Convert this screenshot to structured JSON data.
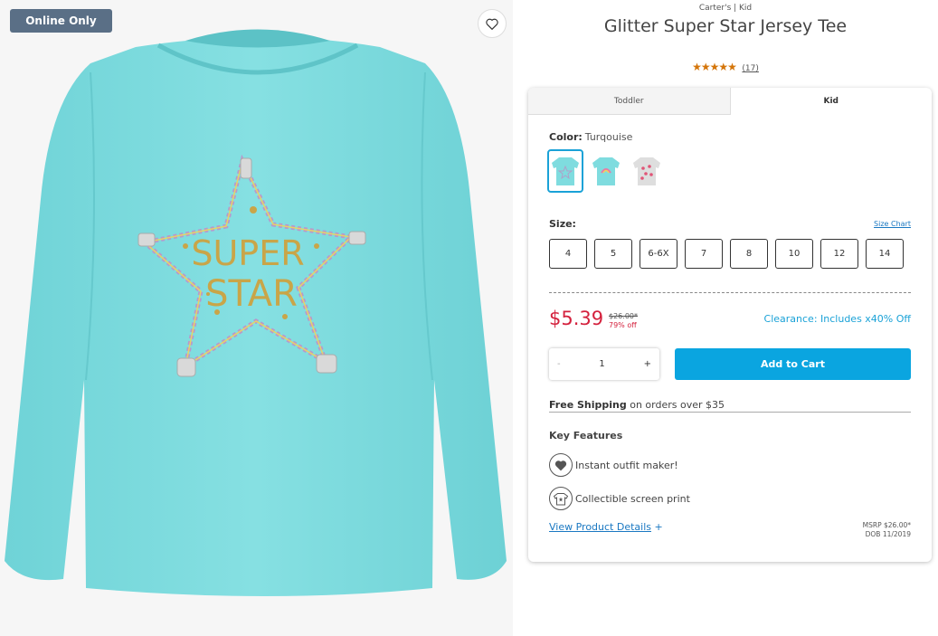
{
  "badge": "Online Only",
  "product": {
    "brand_line": "Carter's | Kid",
    "title": "Glitter Super Star Jersey Tee",
    "stars": "★★★★★",
    "review_count": "(17)",
    "graphic_text_line1": "SUPER",
    "graphic_text_line2": "STAR"
  },
  "tabs": [
    {
      "label": "Toddler",
      "active": false
    },
    {
      "label": "Kid",
      "active": true
    }
  ],
  "color": {
    "label": "Color:",
    "value": "Turqouise",
    "swatches": [
      "turquoise-star-tee",
      "turquoise-rainbow-tee",
      "heather-heart-tee"
    ]
  },
  "size": {
    "label": "Size:",
    "chart_link": "Size Chart",
    "options": [
      "4",
      "5",
      "6-6X",
      "7",
      "8",
      "10",
      "12",
      "14"
    ]
  },
  "pricing": {
    "price": "$5.39",
    "was": "$26.00*",
    "off": "79% off",
    "clearance": "Clearance: Includes x40% Off"
  },
  "quantity": {
    "minus": "-",
    "value": "1",
    "plus": "+"
  },
  "add_to_cart": "Add to Cart",
  "shipping": {
    "bold": "Free Shipping",
    "rest": "on orders over $35"
  },
  "key_features": {
    "title": "Key Features",
    "items": [
      "Instant outfit maker!",
      "Collectible screen print"
    ]
  },
  "details": {
    "link": "View Product Details",
    "plus": "+"
  },
  "msrp": {
    "line1": "MSRP $26.00*",
    "line2": "DOB 11/2019"
  },
  "colors": {
    "accent": "#0aa5e0",
    "sale": "#d4213d",
    "badge": "#5a6f86",
    "shirt": "#7fdcdf",
    "star_rating": "#d4750a"
  }
}
